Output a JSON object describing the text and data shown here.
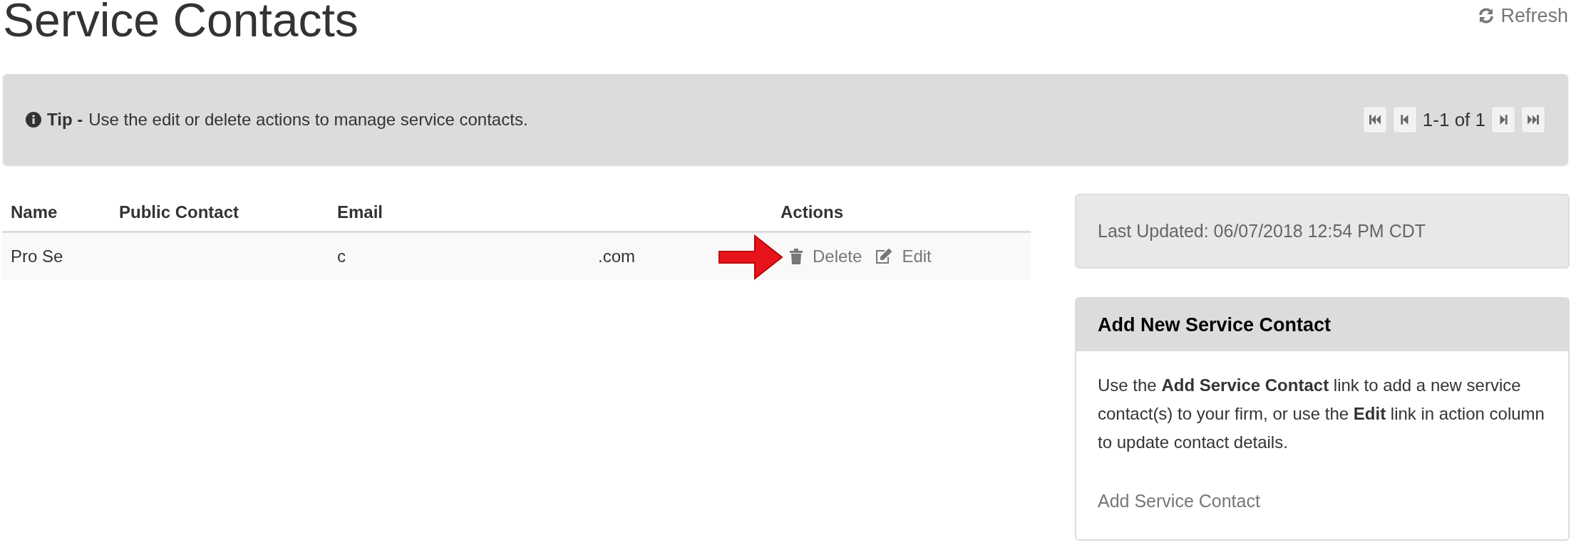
{
  "title": "Service Contacts",
  "refresh": "Refresh",
  "tip": {
    "label": "Tip -",
    "text": "Use the edit or delete actions to manage service contacts."
  },
  "pager": {
    "range": "1-1 of 1"
  },
  "table": {
    "columns": [
      "Name",
      "Public Contact",
      "Email",
      "Actions"
    ],
    "rows": [
      {
        "name": "Pro Se",
        "public_contact": "",
        "email_start": "c",
        "email_end": ".com",
        "actions": [
          "Delete",
          "Edit"
        ]
      }
    ]
  },
  "last_updated": "Last Updated: 06/07/2018 12:54 PM CDT",
  "add_panel": {
    "title": "Add New Service Contact",
    "body": "Use the **Add Service Contact** link to add a new service contact(s) to your firm, or use the **Edit** link in action column to update contact details.",
    "link": "Add Service Contact"
  }
}
